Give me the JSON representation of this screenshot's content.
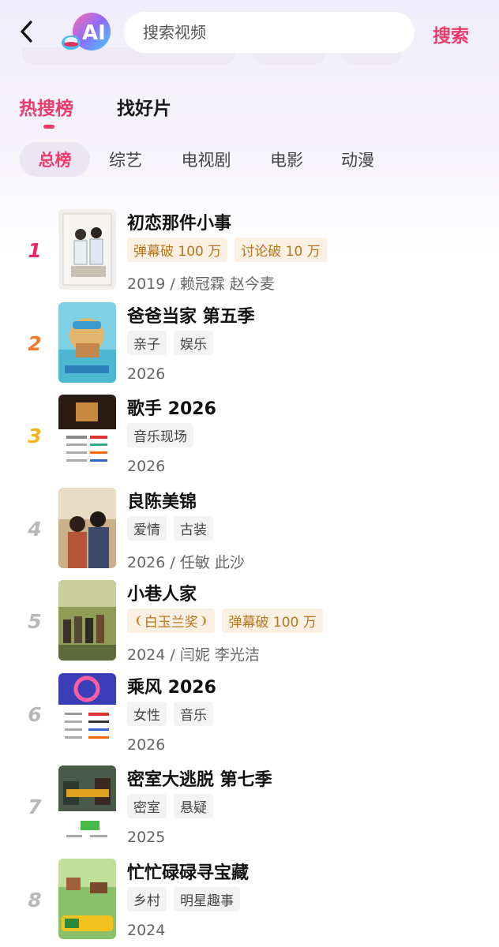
{
  "header": {
    "back_icon": "chevron-left-icon",
    "ai_logo_text": "AI",
    "search_placeholder": "搜索视频",
    "search_button": "搜索"
  },
  "main_tabs": [
    {
      "label": "热搜榜",
      "active": true
    },
    {
      "label": "找好片",
      "active": false
    }
  ],
  "sub_tabs": [
    {
      "label": "总榜",
      "active": true
    },
    {
      "label": "综艺",
      "active": false
    },
    {
      "label": "电视剧",
      "active": false
    },
    {
      "label": "电影",
      "active": false
    },
    {
      "label": "动漫",
      "active": false
    }
  ],
  "colors": {
    "accent": "#ef3b6b",
    "rank1": "#e8266a",
    "rank2": "#f27a2a",
    "rank3": "#f5b21c",
    "rank_other": "#b8b8bc",
    "gold_tag_bg": "#fbf0e2",
    "gold_tag_text": "#b5761f"
  },
  "list": [
    {
      "rank": "1",
      "title": "初恋那件小事",
      "tags": [
        {
          "text": "弹幕破 100 万",
          "style": "gold"
        },
        {
          "text": "讨论破 10 万",
          "style": "gold"
        }
      ],
      "meta": "2019 / 赖冠霖 赵今麦"
    },
    {
      "rank": "2",
      "title": "爸爸当家 第五季",
      "tags": [
        {
          "text": "亲子",
          "style": "gray"
        },
        {
          "text": "娱乐",
          "style": "gray"
        }
      ],
      "meta": "2026"
    },
    {
      "rank": "3",
      "title": "歌手 2026",
      "tags": [
        {
          "text": "音乐现场",
          "style": "gray"
        }
      ],
      "meta": "2026"
    },
    {
      "rank": "4",
      "title": "良陈美锦",
      "tags": [
        {
          "text": "爱情",
          "style": "gray"
        },
        {
          "text": "古装",
          "style": "gray"
        }
      ],
      "meta": "2026 / 任敏 此沙"
    },
    {
      "rank": "5",
      "title": "小巷人家",
      "tags": [
        {
          "text": "白玉兰奖",
          "style": "gold",
          "laurel": true
        },
        {
          "text": "弹幕破 100 万",
          "style": "gold"
        }
      ],
      "meta": "2024 / 闫妮 李光洁"
    },
    {
      "rank": "6",
      "title": "乘风 2026",
      "tags": [
        {
          "text": "女性",
          "style": "gray"
        },
        {
          "text": "音乐",
          "style": "gray"
        }
      ],
      "meta": "2026"
    },
    {
      "rank": "7",
      "title": "密室大逃脱 第七季",
      "tags": [
        {
          "text": "密室",
          "style": "gray"
        },
        {
          "text": "悬疑",
          "style": "gray"
        }
      ],
      "meta": "2025"
    },
    {
      "rank": "8",
      "title": "忙忙碌碌寻宝藏",
      "tags": [
        {
          "text": "乡村",
          "style": "gray"
        },
        {
          "text": "明星趣事",
          "style": "gray"
        }
      ],
      "meta": "2024"
    }
  ]
}
